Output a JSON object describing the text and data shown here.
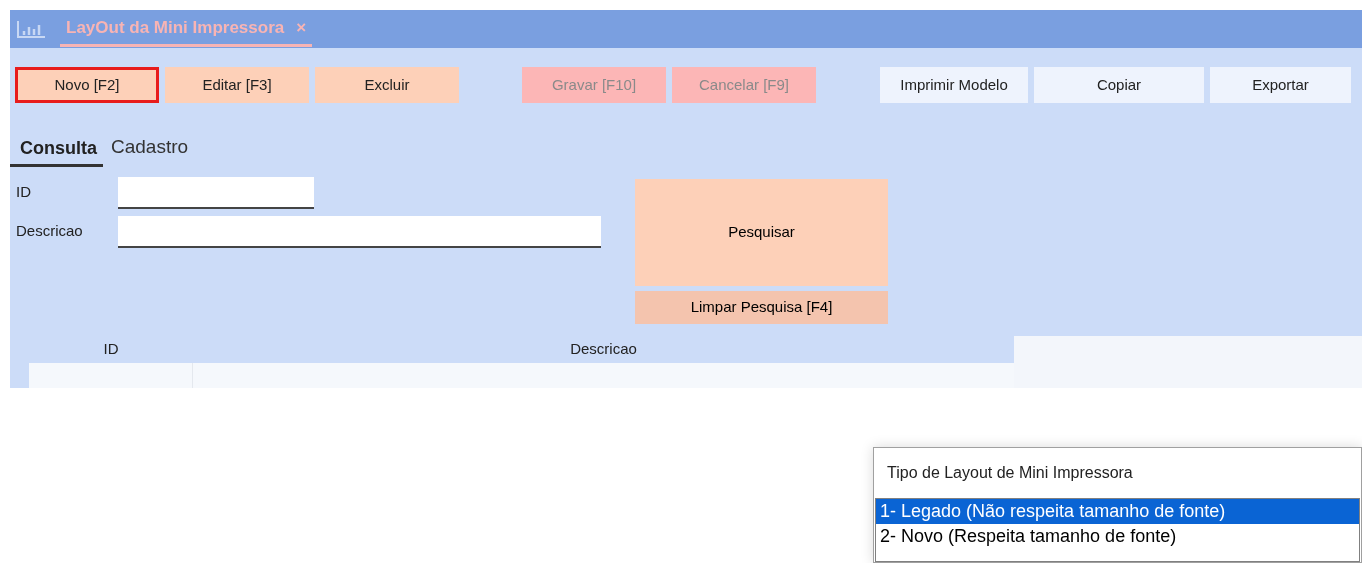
{
  "window": {
    "tab_title": "LayOut da Mini Impressora",
    "close_glyph": "×"
  },
  "toolbar": [
    {
      "label": "Novo [F2]",
      "kind": "action",
      "focused": true,
      "disabled": false
    },
    {
      "label": "Editar [F3]",
      "kind": "action",
      "focused": false,
      "disabled": false
    },
    {
      "label": "Excluir",
      "kind": "action",
      "focused": false,
      "disabled": false
    },
    {
      "label": "Gravar [F10]",
      "kind": "action",
      "focused": false,
      "disabled": true
    },
    {
      "label": "Cancelar [F9]",
      "kind": "action",
      "focused": false,
      "disabled": true
    },
    {
      "label": "Imprimir Modelo",
      "kind": "utility",
      "focused": false,
      "disabled": false
    },
    {
      "label": "Copiar",
      "kind": "utility",
      "focused": false,
      "disabled": false
    },
    {
      "label": "Exportar",
      "kind": "utility",
      "focused": false,
      "disabled": false
    }
  ],
  "tabs": [
    {
      "label": "Consulta",
      "selected": true
    },
    {
      "label": "Cadastro",
      "selected": false
    }
  ],
  "search": {
    "fields": [
      {
        "label": "ID"
      },
      {
        "label": "Descricao"
      }
    ],
    "search_button": "Pesquisar",
    "clear_button": "Limpar Pesquisa [F4]"
  },
  "table": {
    "columns": [
      "ID",
      "Descricao"
    ]
  },
  "popup": {
    "title": "Tipo de Layout de Mini Impressora",
    "options": [
      {
        "label": "1- Legado (Não respeita tamanho de fonte)",
        "selected": true
      },
      {
        "label": "2- Novo (Respeita tamanho de fonte)",
        "selected": false
      }
    ]
  }
}
